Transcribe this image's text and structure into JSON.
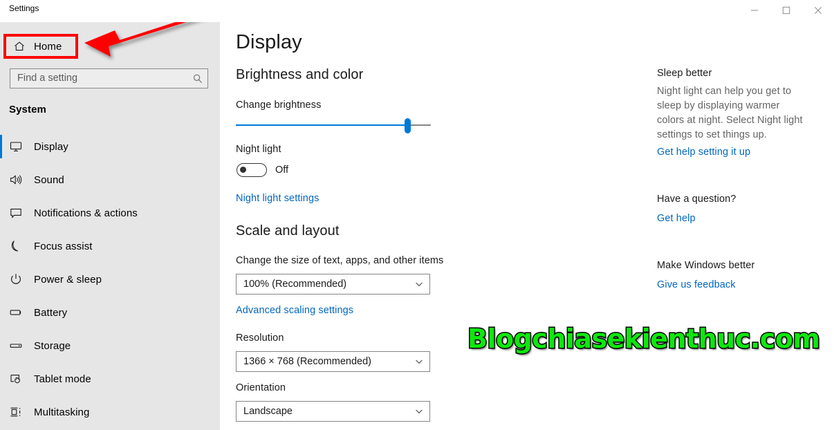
{
  "window": {
    "title": "Settings",
    "controls": [
      {
        "name": "minimize-button",
        "glyph": "minimize-icon"
      },
      {
        "name": "maximize-button",
        "glyph": "maximize-icon"
      },
      {
        "name": "close-button",
        "glyph": "close-icon"
      }
    ]
  },
  "sidebar": {
    "home": {
      "label": "Home",
      "icon": "home-icon"
    },
    "search": {
      "placeholder": "Find a setting",
      "value": "",
      "icon": "search-icon"
    },
    "section_title": "System",
    "items": [
      {
        "label": "Display",
        "icon": "monitor-icon",
        "selected": true
      },
      {
        "label": "Sound",
        "icon": "speaker-icon",
        "selected": false
      },
      {
        "label": "Notifications & actions",
        "icon": "notification-icon",
        "selected": false
      },
      {
        "label": "Focus assist",
        "icon": "moon-icon",
        "selected": false
      },
      {
        "label": "Power & sleep",
        "icon": "power-icon",
        "selected": false
      },
      {
        "label": "Battery",
        "icon": "battery-icon",
        "selected": false
      },
      {
        "label": "Storage",
        "icon": "storage-icon",
        "selected": false
      },
      {
        "label": "Tablet mode",
        "icon": "tablet-hand-icon",
        "selected": false
      },
      {
        "label": "Multitasking",
        "icon": "multitasking-icon",
        "selected": false
      }
    ]
  },
  "main": {
    "page_title": "Display",
    "groups": {
      "brightness_and_color": "Brightness and color",
      "scale_and_layout": "Scale and layout"
    },
    "brightness": {
      "label": "Change brightness",
      "value_percent": 88
    },
    "night_light": {
      "label": "Night light",
      "state": "Off",
      "settings_link": "Night light settings"
    },
    "scale": {
      "label": "Change the size of text, apps, and other items",
      "selected": "100% (Recommended)",
      "advanced_link": "Advanced scaling settings"
    },
    "resolution": {
      "label": "Resolution",
      "selected": "1366 × 768 (Recommended)"
    },
    "orientation": {
      "label": "Orientation",
      "selected": "Landscape"
    }
  },
  "help_pane": {
    "sleep_better": {
      "heading": "Sleep better",
      "body": "Night light can help you get to sleep by displaying warmer colors at night. Select Night light settings to set things up.",
      "link": "Get help setting it up"
    },
    "have_a_question": {
      "heading": "Have a question?",
      "link": "Get help"
    },
    "make_windows_better": {
      "heading": "Make Windows better",
      "link": "Give us feedback"
    }
  },
  "annotations": {
    "watermark": "Blogchiasekienthuc.com",
    "highlight_color": "#fe0000",
    "arrow_color": "#fe0000",
    "accent_color": "#0078d7",
    "link_color": "#0067c0"
  }
}
